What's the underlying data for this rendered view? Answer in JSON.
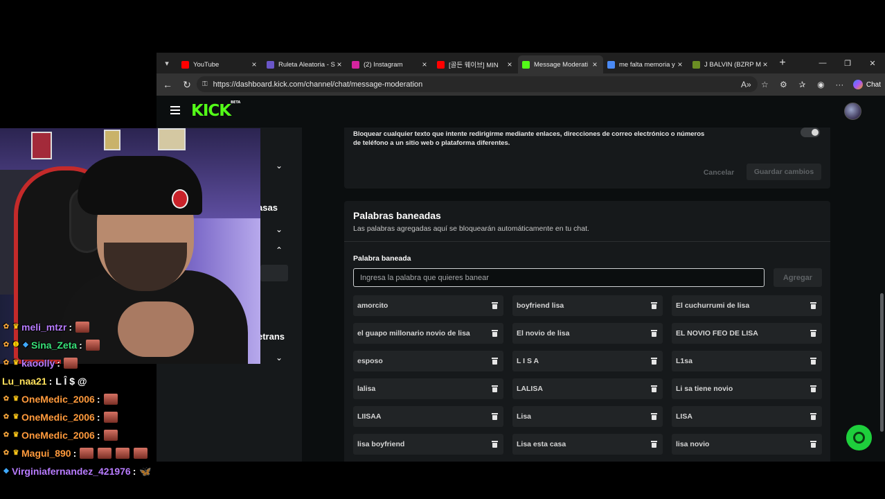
{
  "browser": {
    "tabs": [
      {
        "label": "YouTube",
        "favicon": "youtube-icon",
        "color": "#ff0000",
        "active": false
      },
      {
        "label": "Ruleta Aleatoria - S",
        "favicon": "wheel-icon",
        "color": "#6a56c8",
        "active": false
      },
      {
        "label": "(2) Instagram",
        "favicon": "instagram-icon",
        "color": "#d6249f",
        "active": false
      },
      {
        "label": "[골든 웨이브] MIN",
        "favicon": "youtube-icon",
        "color": "#ff0000",
        "active": false
      },
      {
        "label": "Message Moderati",
        "favicon": "kick-icon",
        "color": "#53fc18",
        "active": true
      },
      {
        "label": "me falta memoria y",
        "favicon": "search-icon",
        "color": "#4a8af4",
        "active": false
      },
      {
        "label": "J BALVIN (BZRP M",
        "favicon": "genius-icon",
        "color": "#6b8e23",
        "active": false
      }
    ],
    "url": "https://dashboard.kick.com/channel/chat/message-moderation",
    "chat_button": "Chat"
  },
  "site": {
    "logo": "KICK",
    "logo_badge": "BETA"
  },
  "sidebar": {
    "partial_texts": [
      "asas",
      "etrans"
    ]
  },
  "link_filter": {
    "description": "Bloquear cualquier texto que intente redirigirme mediante enlaces, direcciones de correo electrónico o números de teléfono a un sitio web o plataforma diferentes.",
    "enabled": false,
    "cancel_label": "Cancelar",
    "save_label": "Guardar cambios"
  },
  "banned_words": {
    "title": "Palabras baneadas",
    "subtitle": "Las palabras agregadas aquí se bloquearán automáticamente en tu chat.",
    "field_label": "Palabra baneada",
    "placeholder": "Ingresa la palabra que quieres banear",
    "add_label": "Agregar",
    "words": [
      "amorcito",
      "boyfriend lisa",
      "El cuchurrumi de lisa",
      "el guapo millonario novio de lisa",
      "El novio de lisa",
      "EL NOVIO FEO DE LISA",
      "esposo",
      "L I S A",
      "L1sa",
      "lalisa",
      "LALISA",
      "Li sa tiene novio",
      "LIISAA",
      "Lisa",
      "LISA",
      "lisa boyfriend",
      "Lisa esta casa",
      "lisa novio"
    ]
  },
  "chat_overlay": {
    "messages": [
      {
        "user": "meli_mtzr",
        "color": "#b87cff",
        "badges": [
          "sub-icon",
          "crown-icon"
        ],
        "emotes": 1,
        "text": ""
      },
      {
        "user": "Sina_Zeta",
        "color": "#39e37a",
        "badges": [
          "sub-icon",
          "tier-icon",
          "gem-icon"
        ],
        "emotes": 1,
        "text": ""
      },
      {
        "user": "kaoolly",
        "color": "#b87cff",
        "badges": [
          "sub-icon",
          "crown-icon"
        ],
        "emotes": 1,
        "text": ""
      },
      {
        "user": "Lu_naa21",
        "color": "#ffe15c",
        "badges": [],
        "emotes": 0,
        "text": "L Î $ @"
      },
      {
        "user": "OneMedic_2006",
        "color": "#ff9a3c",
        "badges": [
          "sub-icon",
          "crown-icon"
        ],
        "emotes": 1,
        "text": ""
      },
      {
        "user": "OneMedic_2006",
        "color": "#ff9a3c",
        "badges": [
          "sub-icon",
          "crown-icon"
        ],
        "emotes": 1,
        "text": ""
      },
      {
        "user": "OneMedic_2006",
        "color": "#ff9a3c",
        "badges": [
          "sub-icon",
          "crown-icon"
        ],
        "emotes": 1,
        "text": ""
      },
      {
        "user": "Magui_890",
        "color": "#ff9a3c",
        "badges": [
          "sub-icon",
          "crown-icon"
        ],
        "emotes": 4,
        "text": ""
      },
      {
        "user": "Virginiafernandez_421976",
        "color": "#b87cff",
        "badges": [
          "gem-icon"
        ],
        "emotes": 0,
        "text": "🦋"
      }
    ]
  }
}
